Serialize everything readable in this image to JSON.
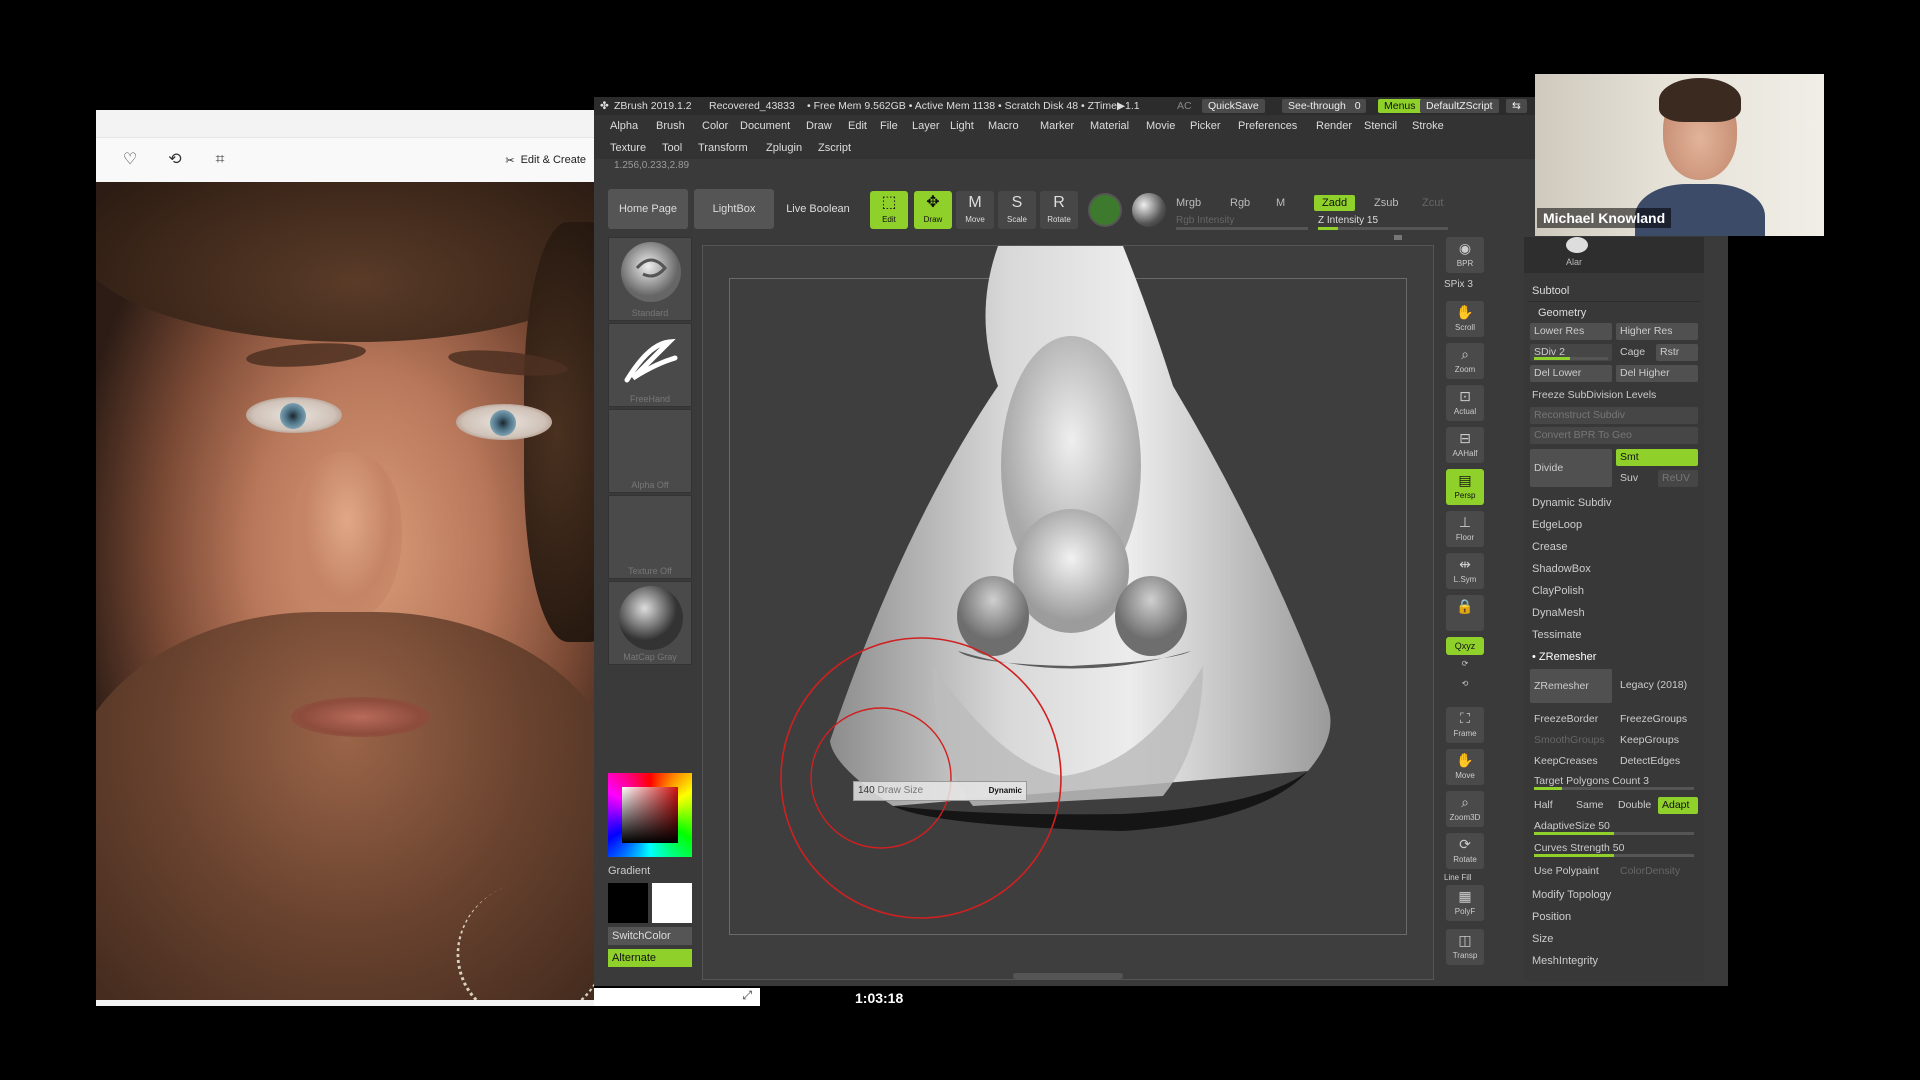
{
  "photo_viewer": {
    "toolbar": {
      "favorite_icon": "heart-icon",
      "rotate_icon": "rotate-icon",
      "crop_icon": "crop-icon",
      "edit_create_label": "Edit & Create"
    }
  },
  "zbrush": {
    "title": {
      "app": "ZBrush 2019.1.2",
      "file": "Recovered_43833",
      "stats": "• Free Mem 9.562GB • Active Mem 1138 • Scratch Disk 48 • ZTime▶1.1",
      "ac": "AC",
      "quicksave": "QuickSave",
      "seethrough": "See-through",
      "seethrough_value": "0",
      "menus": "Menus",
      "default_zscript": "DefaultZScript"
    },
    "menu_row1": [
      "Alpha",
      "Brush",
      "Color",
      "Document",
      "Draw",
      "Edit",
      "File",
      "Layer",
      "Light",
      "Macro",
      "Marker",
      "Material",
      "Movie",
      "Picker",
      "Preferences",
      "Render",
      "Stencil",
      "Stroke"
    ],
    "menu_row2": [
      "Texture",
      "Tool",
      "Transform",
      "Zplugin",
      "Zscript"
    ],
    "coords": "1.256,0.233,2.89",
    "topbar": {
      "home_page": "Home Page",
      "lightbox": "LightBox",
      "live_boolean": "Live Boolean",
      "edit": "Edit",
      "draw": "Draw",
      "move": "Move",
      "scale": "Scale",
      "rotate": "Rotate",
      "mrgb": "Mrgb",
      "rgb": "Rgb",
      "m": "M",
      "zadd": "Zadd",
      "zsub": "Zsub",
      "zcut": "Zcut",
      "rgb_intensity": "Rgb Intensity",
      "z_intensity_label": "Z Intensity",
      "z_intensity_value": "15"
    },
    "left_tray": {
      "brush": "Standard",
      "stroke": "FreeHand",
      "alpha": "Alpha Off",
      "texture": "Texture Off",
      "material": "MatCap Gray",
      "gradient": "Gradient",
      "switch_color": "SwitchColor",
      "alternate": "Alternate"
    },
    "canvas": {
      "brush_readout": "140",
      "draw_size_label": "Draw Size",
      "dynamic": "Dynamic"
    },
    "right_shelf": {
      "bpr": "BPR",
      "spix_label": "SPix",
      "spix_value": "3",
      "scroll": "Scroll",
      "zoom": "Zoom",
      "actual": "Actual",
      "aahalf": "AAHalf",
      "persp": "Persp",
      "floor": "Floor",
      "local": "L.Sym",
      "xyz": "Qxyz",
      "frame": "Frame",
      "move": "Move",
      "zoom3d": "Zoom3D",
      "rotate": "Rotate",
      "line_fill": "Line Fill",
      "polyf": "PolyF",
      "transp": "Transp"
    },
    "right_panel": {
      "avatar_label": "Alar",
      "subtool": "Subtool",
      "geometry": "Geometry",
      "lower_res": "Lower Res",
      "higher_res": "Higher Res",
      "sdiv_label": "SDiv",
      "sdiv_value": "2",
      "cage": "Cage",
      "rstr": "Rstr",
      "del_lower": "Del Lower",
      "del_higher": "Del Higher",
      "freeze_subdiv": "Freeze SubDivision Levels",
      "reconstruct": "Reconstruct Subdiv",
      "convert_bpr": "Convert BPR To Geo",
      "divide": "Divide",
      "smt": "Smt",
      "suv": "Suv",
      "reuv": "ReUV",
      "items": [
        "Dynamic Subdiv",
        "EdgeLoop",
        "Crease",
        "ShadowBox",
        "ClayPolish",
        "DynaMesh",
        "Tessimate"
      ],
      "zremesher_head": "ZRemesher",
      "zremesher_btn": "ZRemesher",
      "legacy": "Legacy (2018)",
      "freeze_border": "FreezeBorder",
      "freeze_groups": "FreezeGroups",
      "smooth_groups": "SmoothGroups",
      "keep_groups": "KeepGroups",
      "keep_creases": "KeepCreases",
      "detect_edges": "DetectEdges",
      "target_polys_label": "Target Polygons Count",
      "target_polys_value": "3",
      "half": "Half",
      "same": "Same",
      "double": "Double",
      "adapt": "Adapt",
      "adaptive_size_label": "AdaptiveSize",
      "adaptive_size_value": "50",
      "curves_strength_label": "Curves Strength",
      "curves_strength_value": "50",
      "use_polypaint": "Use Polypaint",
      "color_density": "ColorDensity",
      "bottom_items": [
        "Modify Topology",
        "Position",
        "Size",
        "MeshIntegrity"
      ]
    }
  },
  "webcam": {
    "name": "Michael Knowland"
  },
  "timecode": "1:03:18"
}
